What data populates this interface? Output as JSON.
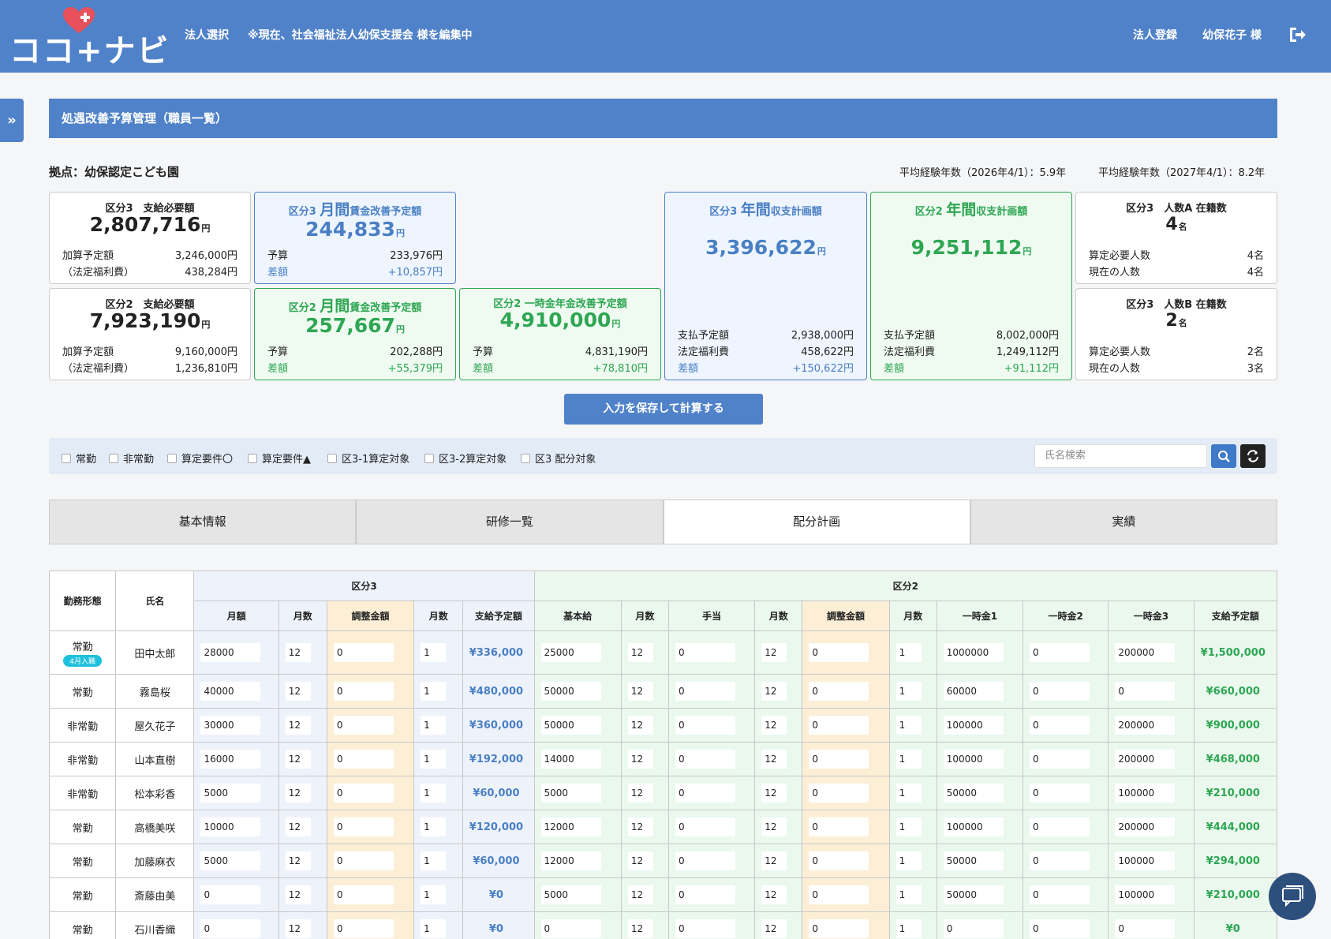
{
  "header": {
    "logo_text": "ココ+ナビ",
    "corp_select": "法人選択",
    "editing_notice": "※現在、社会福祉法人幼保支援会 様を編集中",
    "corp_register": "法人登録",
    "user": "幼保花子 様"
  },
  "sidebar": {
    "toggle": "»"
  },
  "page_title": "処遇改善予算管理（職員一覧）",
  "site_label": "拠点：幼保認定こども園",
  "avg_2026": "平均経験年数（2026年4/1）：5.9年",
  "avg_2027": "平均経験年数（2027年4/1）：8.2年",
  "cards": {
    "k3_required": {
      "title": "区分3　支給必要額",
      "amount": "2,807,716",
      "unit": "円",
      "r1_label": "加算予定額",
      "r1_value": "3,246,000円",
      "r2_label": "（法定福利費）",
      "r2_value": "438,284円"
    },
    "k2_required": {
      "title": "区分2　支給必要額",
      "amount": "7,923,190",
      "unit": "円",
      "r1_label": "加算予定額",
      "r1_value": "9,160,000円",
      "r2_label": "（法定福利費）",
      "r2_value": "1,236,810円"
    },
    "k3_monthly": {
      "title_a": "区分3 ",
      "title_big": "月間",
      "title_b": "賃金改善予定額",
      "amount": "244,833",
      "unit": "円",
      "r1_label": "予算",
      "r1_value": "233,976円",
      "r2_label": "差額",
      "r2_value": "+10,857円"
    },
    "k2_monthly": {
      "title_a": "区分2 ",
      "title_big": "月間",
      "title_b": "賃金改善予定額",
      "amount": "257,667",
      "unit": "円",
      "r1_label": "予算",
      "r1_value": "202,288円",
      "r2_label": "差額",
      "r2_value": "+55,379円"
    },
    "k2_lump": {
      "title": "区分2 一時金年金改善予定額",
      "amount": "4,910,000",
      "unit": "円",
      "r1_label": "予算",
      "r1_value": "4,831,190円",
      "r2_label": "差額",
      "r2_value": "+78,810円"
    },
    "k3_annual": {
      "title_a": "区分3 ",
      "title_big": "年間",
      "title_b": "収支計画額",
      "amount": "3,396,622",
      "unit": "円",
      "r1_label": "支払予定額",
      "r1_value": "2,938,000円",
      "r2_label": "法定福利費",
      "r2_value": "458,622円",
      "r3_label": "差額",
      "r3_value": "+150,622円"
    },
    "k2_annual": {
      "title_a": "区分2 ",
      "title_big": "年間",
      "title_b": "収支計画額",
      "amount": "9,251,112",
      "unit": "円",
      "r1_label": "支払予定額",
      "r1_value": "8,002,000円",
      "r2_label": "法定福利費",
      "r2_value": "1,249,112円",
      "r3_label": "差額",
      "r3_value": "+91,112円"
    },
    "k3_staffA": {
      "title": "区分3　人数A 在籍数",
      "count": "4",
      "unit": "名",
      "r1_label": "算定必要人数",
      "r1_value": "4名",
      "r2_label": "現在の人数",
      "r2_value": "4名"
    },
    "k3_staffB": {
      "title": "区分3　人数B 在籍数",
      "count": "2",
      "unit": "名",
      "r1_label": "算定必要人数",
      "r1_value": "2名",
      "r2_label": "現在の人数",
      "r2_value": "3名"
    }
  },
  "save_button": "入力を保存して計算する",
  "filters": [
    "常勤",
    "非常勤",
    "算定要件〇",
    "算定要件▲",
    "区3-1算定対象",
    "区3-2算定対象",
    "区3 配分対象"
  ],
  "search_placeholder": "氏名検索",
  "tabs": [
    "基本情報",
    "研修一覧",
    "配分計画",
    "実績"
  ],
  "table": {
    "group_k3": "区分3",
    "group_k2": "区分2",
    "col_type": "勤務形態",
    "col_name": "氏名",
    "k3_cols": [
      "月額",
      "月数",
      "調整金額",
      "月数",
      "支給予定額"
    ],
    "k2_cols": [
      "基本給",
      "月数",
      "手当",
      "月数",
      "調整金額",
      "月数",
      "一時金1",
      "一時金2",
      "一時金3",
      "支給予定額"
    ],
    "rows": [
      {
        "type": "常勤",
        "badge": "4月入職",
        "name": "田中太郎",
        "k3": [
          "28000",
          "12",
          "0",
          "1"
        ],
        "k3_total": "¥336,000",
        "k2": [
          "25000",
          "12",
          "0",
          "12",
          "0",
          "1",
          "1000000",
          "0",
          "200000"
        ],
        "k2_total": "¥1,500,000"
      },
      {
        "type": "常勤",
        "name": "霧島桜",
        "k3": [
          "40000",
          "12",
          "0",
          "1"
        ],
        "k3_total": "¥480,000",
        "k2": [
          "50000",
          "12",
          "0",
          "12",
          "0",
          "1",
          "60000",
          "0",
          "0"
        ],
        "k2_total": "¥660,000"
      },
      {
        "type": "非常勤",
        "name": "屋久花子",
        "k3": [
          "30000",
          "12",
          "0",
          "1"
        ],
        "k3_total": "¥360,000",
        "k2": [
          "50000",
          "12",
          "0",
          "12",
          "0",
          "1",
          "100000",
          "0",
          "200000"
        ],
        "k2_total": "¥900,000"
      },
      {
        "type": "非常勤",
        "name": "山本直樹",
        "k3": [
          "16000",
          "12",
          "0",
          "1"
        ],
        "k3_total": "¥192,000",
        "k2": [
          "14000",
          "12",
          "0",
          "12",
          "0",
          "1",
          "100000",
          "0",
          "200000"
        ],
        "k2_total": "¥468,000"
      },
      {
        "type": "非常勤",
        "name": "松本彩香",
        "k3": [
          "5000",
          "12",
          "0",
          "1"
        ],
        "k3_total": "¥60,000",
        "k2": [
          "5000",
          "12",
          "0",
          "12",
          "0",
          "1",
          "50000",
          "0",
          "100000"
        ],
        "k2_total": "¥210,000"
      },
      {
        "type": "常勤",
        "name": "高橋美咲",
        "k3": [
          "10000",
          "12",
          "0",
          "1"
        ],
        "k3_total": "¥120,000",
        "k2": [
          "12000",
          "12",
          "0",
          "12",
          "0",
          "1",
          "100000",
          "0",
          "200000"
        ],
        "k2_total": "¥444,000"
      },
      {
        "type": "常勤",
        "name": "加藤麻衣",
        "k3": [
          "5000",
          "12",
          "0",
          "1"
        ],
        "k3_total": "¥60,000",
        "k2": [
          "12000",
          "12",
          "0",
          "12",
          "0",
          "1",
          "50000",
          "0",
          "100000"
        ],
        "k2_total": "¥294,000"
      },
      {
        "type": "常勤",
        "name": "斎藤由美",
        "k3": [
          "0",
          "12",
          "0",
          "1"
        ],
        "k3_total": "¥0",
        "k2": [
          "5000",
          "12",
          "0",
          "12",
          "0",
          "1",
          "50000",
          "0",
          "100000"
        ],
        "k2_total": "¥210,000"
      },
      {
        "type": "常勤",
        "name": "石川香織",
        "k3": [
          "0",
          "12",
          "0",
          "1"
        ],
        "k3_total": "¥0",
        "k2": [
          "0",
          "12",
          "0",
          "12",
          "0",
          "1",
          "0",
          "0",
          "0"
        ],
        "k2_total": "¥0"
      }
    ]
  },
  "colors": {
    "brand": "#5082c9",
    "blue_text": "#4a7fc4",
    "green_text": "#2ea653",
    "heart": "#e8505b"
  }
}
